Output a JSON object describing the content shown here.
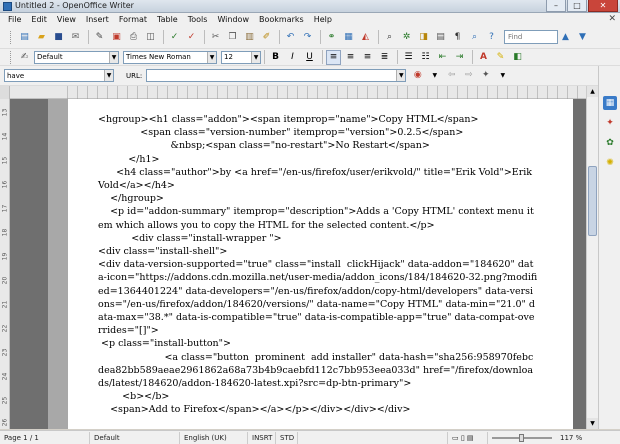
{
  "window": {
    "title": "Untitled 2 - OpenOffice Writer",
    "minimize": "–",
    "maximize": "□",
    "close": "✕"
  },
  "menu": [
    "File",
    "Edit",
    "View",
    "Insert",
    "Format",
    "Table",
    "Tools",
    "Window",
    "Bookmarks",
    "Help"
  ],
  "menu_doc_close": "✕",
  "toolbar": {
    "find_placeholder": "Find",
    "style": "Default",
    "font": "Times New Roman",
    "size": "12",
    "bold": "B",
    "italic": "I",
    "underline": "U"
  },
  "navbar": {
    "search_value": "have",
    "url_label": "URL:"
  },
  "ruler": {
    "vertical_numbers": [
      "13",
      "14",
      "15",
      "16",
      "17",
      "18",
      "19",
      "20",
      "21",
      "22",
      "23",
      "24",
      "25",
      "26"
    ]
  },
  "document": {
    "lines": [
      "<hgroup><h1 class=\"addon\"><span itemprop=\"name\">Copy HTML</span>",
      "              <span class=\"version-number\" itemprop=\"version\">0.2.5</span>",
      "                        &nbsp;<span class=\"no-restart\">No Restart</span>",
      "          </h1>",
      "      <h4 class=\"author\">by <a href=\"/en-us/firefox/user/erikvold/\" title=\"Erik Vold\">Erik Vold</a></h4>",
      "    </hgroup>",
      "    <p id=\"addon-summary\" itemprop=\"description\">Adds a 'Copy HTML' context menu item which allows you to copy the HTML for the selected content.</p>",
      "           <div class=\"install-wrapper \">",
      "<div class=\"install-shell\">",
      "<div data-version-supported=\"true\" class=\"install  clickHijack\" data-addon=\"184620\" data-icon=\"https://addons.cdn.mozilla.net/user-media/addon_icons/184/184620-32.png?modified=1364401224\" data-developers=\"/en-us/firefox/addon/copy-html/developers\" data-versions=\"/en-us/firefox/addon/184620/versions/\" data-name=\"Copy HTML\" data-min=\"21.0\" data-max=\"38.*\" data-is-compatible=\"true\" data-is-compatible-app=\"true\" data-compat-overrides=\"[]\">",
      " <p class=\"install-button\">",
      "                      <a class=\"button  prominent  add installer\" data-hash=\"sha256:958970febcdea82bb589aeae2961862a68a73b4b9caebfd112c7bb953eea033d\" href=\"/firefox/downloads/latest/184620/addon-184620-latest.xpi?src=dp-btn-primary\">",
      "        <b></b>",
      "    <span>Add to Firefox</span></a></p></div></div></div>"
    ]
  },
  "status": {
    "page": "Page 1 / 1",
    "style": "Default",
    "language": "English (UK)",
    "insert": "INSRT",
    "selection": "STD",
    "zoom": "117 %"
  },
  "icons": {
    "toolbar1": [
      "new-doc-icon",
      "open-icon",
      "save-icon",
      "email-icon",
      "edit-icon",
      "export-pdf-icon",
      "print-icon",
      "preview-icon",
      "spellcheck-icon",
      "autospell-icon",
      "cut-icon",
      "copy-icon",
      "paste-icon",
      "format-paint-icon",
      "undo-icon",
      "redo-icon",
      "hyperlink-icon",
      "table-icon",
      "show-draw-icon",
      "find-replace-icon",
      "navigator-icon",
      "gallery-icon",
      "datasource-icon",
      "nonprint-icon",
      "zoom-icon",
      "help-icon"
    ]
  }
}
